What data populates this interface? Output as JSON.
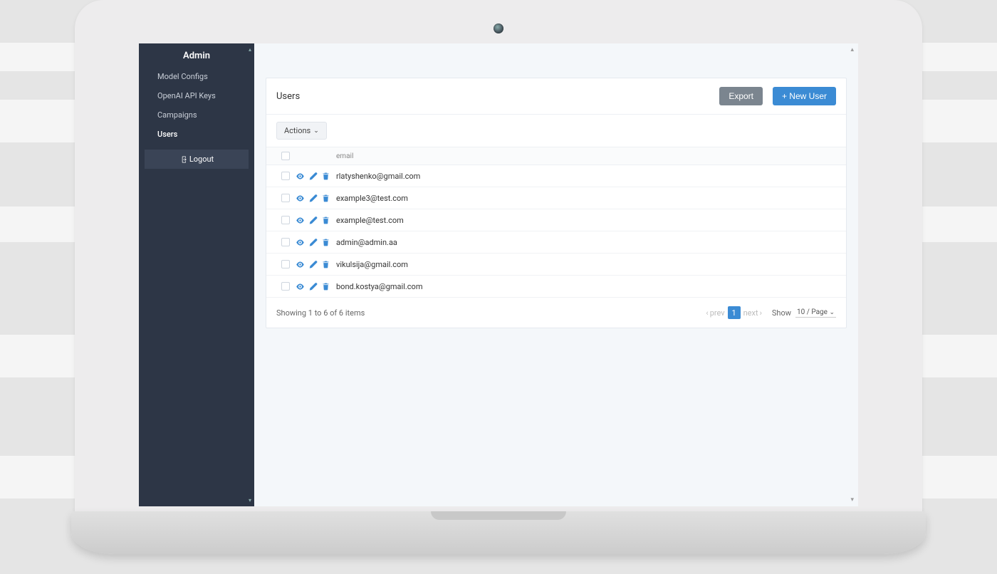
{
  "colors": {
    "accent": "#3b8bd4",
    "sidebar": "#2d3646"
  },
  "sidebar": {
    "title": "Admin",
    "items": [
      {
        "label": "Model Configs"
      },
      {
        "label": "OpenAI API Keys"
      },
      {
        "label": "Campaigns"
      },
      {
        "label": "Users"
      }
    ],
    "logout": "Logout"
  },
  "page": {
    "title": "Users",
    "export_label": "Export",
    "new_label": "+ New User",
    "actions_label": "Actions",
    "email_header": "email",
    "summary": "Showing 1 to 6 of 6 items",
    "prev_label": "prev",
    "next_label": "next",
    "current_page": "1",
    "show_label": "Show",
    "page_size": "10 / Page"
  },
  "rows": [
    {
      "email": "rlatyshenko@gmail.com"
    },
    {
      "email": "example3@test.com"
    },
    {
      "email": "example@test.com"
    },
    {
      "email": "admin@admin.aa"
    },
    {
      "email": "vikulsija@gmail.com"
    },
    {
      "email": "bond.kostya@gmail.com"
    }
  ]
}
